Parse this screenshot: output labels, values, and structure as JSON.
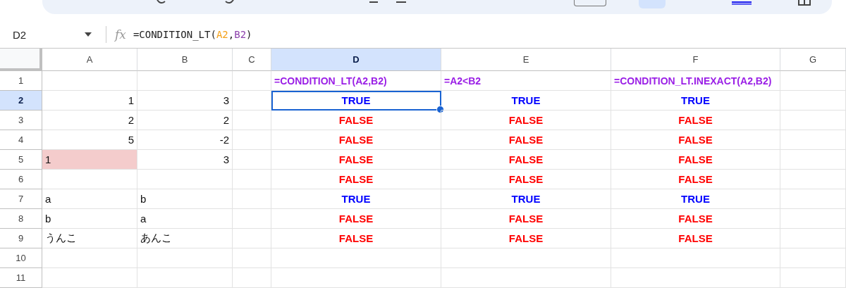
{
  "name_box": {
    "value": "D2"
  },
  "formula_bar": {
    "label": "fx",
    "parts": [
      {
        "text": "=CONDITION_LT(",
        "kind": "plain"
      },
      {
        "text": "A2",
        "kind": "ref",
        "color": "#f4a21b"
      },
      {
        "text": ",",
        "kind": "plain"
      },
      {
        "text": "B2",
        "kind": "ref",
        "color": "#8e44ad"
      },
      {
        "text": ")",
        "kind": "plain"
      }
    ]
  },
  "columns": [
    {
      "label": "A",
      "selected": false
    },
    {
      "label": "B",
      "selected": false
    },
    {
      "label": "C",
      "selected": false
    },
    {
      "label": "D",
      "selected": true
    },
    {
      "label": "E",
      "selected": false
    },
    {
      "label": "F",
      "selected": false
    },
    {
      "label": "G",
      "selected": false
    }
  ],
  "rows": [
    {
      "label": "1",
      "selected": false,
      "cells": [
        null,
        null,
        null,
        {
          "kind": "formula",
          "text": "=CONDITION_LT(A2,B2)"
        },
        {
          "kind": "formula",
          "text": "=A2<B2"
        },
        {
          "kind": "formula",
          "text": "=CONDITION_LT.INEXACT(A2,B2)"
        },
        null
      ]
    },
    {
      "label": "2",
      "selected": true,
      "cells": [
        {
          "kind": "number",
          "text": "1"
        },
        {
          "kind": "number",
          "text": "3"
        },
        null,
        {
          "kind": "boolean",
          "text": "TRUE",
          "color": "#0000ff",
          "selected": true
        },
        {
          "kind": "boolean",
          "text": "TRUE",
          "color": "#0000ff"
        },
        {
          "kind": "boolean",
          "text": "TRUE",
          "color": "#0000ff"
        },
        null
      ]
    },
    {
      "label": "3",
      "selected": false,
      "cells": [
        {
          "kind": "number",
          "text": "2"
        },
        {
          "kind": "number",
          "text": "2"
        },
        null,
        {
          "kind": "boolean",
          "text": "FALSE",
          "color": "#ff0000"
        },
        {
          "kind": "boolean",
          "text": "FALSE",
          "color": "#ff0000"
        },
        {
          "kind": "boolean",
          "text": "FALSE",
          "color": "#ff0000"
        },
        null
      ]
    },
    {
      "label": "4",
      "selected": false,
      "cells": [
        {
          "kind": "number",
          "text": "5"
        },
        {
          "kind": "number",
          "text": "-2"
        },
        null,
        {
          "kind": "boolean",
          "text": "FALSE",
          "color": "#ff0000"
        },
        {
          "kind": "boolean",
          "text": "FALSE",
          "color": "#ff0000"
        },
        {
          "kind": "boolean",
          "text": "FALSE",
          "color": "#ff0000"
        },
        null
      ]
    },
    {
      "label": "5",
      "selected": false,
      "cells": [
        {
          "kind": "text",
          "text": "1",
          "highlighted": true
        },
        {
          "kind": "number",
          "text": "3"
        },
        null,
        {
          "kind": "boolean",
          "text": "FALSE",
          "color": "#ff0000"
        },
        {
          "kind": "boolean",
          "text": "FALSE",
          "color": "#ff0000"
        },
        {
          "kind": "boolean",
          "text": "FALSE",
          "color": "#ff0000"
        },
        null
      ]
    },
    {
      "label": "6",
      "selected": false,
      "cells": [
        null,
        null,
        null,
        {
          "kind": "boolean",
          "text": "FALSE",
          "color": "#ff0000"
        },
        {
          "kind": "boolean",
          "text": "FALSE",
          "color": "#ff0000"
        },
        {
          "kind": "boolean",
          "text": "FALSE",
          "color": "#ff0000"
        },
        null
      ]
    },
    {
      "label": "7",
      "selected": false,
      "cells": [
        {
          "kind": "text",
          "text": "a"
        },
        {
          "kind": "text",
          "text": "b"
        },
        null,
        {
          "kind": "boolean",
          "text": "TRUE",
          "color": "#0000ff"
        },
        {
          "kind": "boolean",
          "text": "TRUE",
          "color": "#0000ff"
        },
        {
          "kind": "boolean",
          "text": "TRUE",
          "color": "#0000ff"
        },
        null
      ]
    },
    {
      "label": "8",
      "selected": false,
      "cells": [
        {
          "kind": "text",
          "text": "b"
        },
        {
          "kind": "text",
          "text": "a"
        },
        null,
        {
          "kind": "boolean",
          "text": "FALSE",
          "color": "#ff0000"
        },
        {
          "kind": "boolean",
          "text": "FALSE",
          "color": "#ff0000"
        },
        {
          "kind": "boolean",
          "text": "FALSE",
          "color": "#ff0000"
        },
        null
      ]
    },
    {
      "label": "9",
      "selected": false,
      "cells": [
        {
          "kind": "text",
          "text": "うんこ"
        },
        {
          "kind": "text",
          "text": "あんこ"
        },
        null,
        {
          "kind": "boolean",
          "text": "FALSE",
          "color": "#ff0000"
        },
        {
          "kind": "boolean",
          "text": "FALSE",
          "color": "#ff0000"
        },
        {
          "kind": "boolean",
          "text": "FALSE",
          "color": "#ff0000"
        },
        null
      ]
    },
    {
      "label": "10",
      "selected": false,
      "cells": [
        null,
        null,
        null,
        null,
        null,
        null,
        null
      ]
    },
    {
      "label": "11",
      "selected": false,
      "cells": [
        null,
        null,
        null,
        null,
        null,
        null,
        null
      ]
    }
  ]
}
